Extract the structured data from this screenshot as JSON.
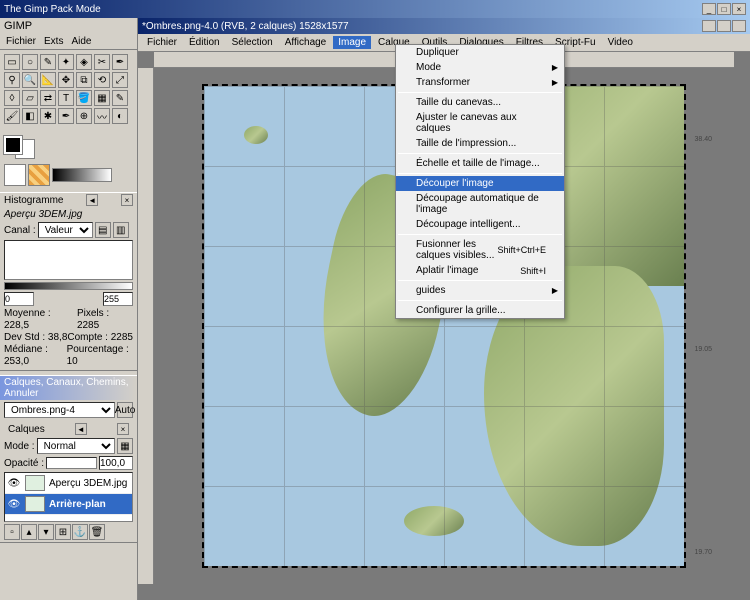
{
  "app": {
    "title": "The Gimp Pack Mode"
  },
  "toolbox": {
    "name": "GIMP",
    "menu": [
      "Fichier",
      "Exts",
      "Aide"
    ]
  },
  "document": {
    "title": "*Ombres.png-4.0 (RVB, 2 calques) 1528x1577",
    "menu": [
      "Fichier",
      "Édition",
      "Sélection",
      "Affichage",
      "Image",
      "Calque",
      "Outils",
      "Dialogues",
      "Filtres",
      "Script-Fu",
      "Video"
    ]
  },
  "image_menu": {
    "items": [
      {
        "label": "Dupliquer"
      },
      {
        "label": "Mode",
        "submenu": true
      },
      {
        "label": "Transformer",
        "submenu": true
      },
      {
        "sep": true
      },
      {
        "label": "Taille du canevas..."
      },
      {
        "label": "Ajuster le canevas aux calques"
      },
      {
        "label": "Taille de l'impression..."
      },
      {
        "sep": true
      },
      {
        "label": "Échelle et taille de l'image..."
      },
      {
        "sep": true
      },
      {
        "label": "Découper l'image",
        "highlighted": true
      },
      {
        "label": "Découpage automatique de l'image"
      },
      {
        "label": "Découpage intelligent..."
      },
      {
        "sep": true
      },
      {
        "label": "Fusionner les calques visibles...",
        "shortcut": "Shift+Ctrl+E"
      },
      {
        "label": "Aplatir l'image",
        "shortcut": "Shift+I"
      },
      {
        "sep": true
      },
      {
        "label": "guides",
        "submenu": true
      },
      {
        "sep": true
      },
      {
        "label": "Configurer la grille..."
      }
    ]
  },
  "histogram": {
    "title": "Histogramme",
    "preview_label": "Aperçu 3DEM.jpg",
    "channel_label": "Canal :",
    "channel_value": "Valeur",
    "range_min": "0",
    "range_max": "255",
    "stats": {
      "moyenne_label": "Moyenne :",
      "moyenne_val": "228,5",
      "pixels_label": "Pixels :",
      "pixels_val": "2285",
      "devstd_label": "Dev Std :",
      "devstd_val": "38,8",
      "compte_label": "Compte :",
      "compte_val": "2285",
      "mediane_label": "Médiane :",
      "mediane_val": "253,0",
      "pourcentage_label": "Pourcentage :",
      "pourcentage_val": "10"
    }
  },
  "layers": {
    "title": "Calques, Canaux, Chemins, Annuler",
    "image_selector": "Ombres.png-4",
    "auto_label": "Auto",
    "tab_label": "Calques",
    "mode_label": "Mode :",
    "mode_value": "Normal",
    "opacity_label": "Opacité :",
    "opacity_value": "100,0",
    "layer1": "Aperçu 3DEM.jpg",
    "layer2": "Arrière-plan"
  },
  "canvas": {
    "coords": [
      "38.40",
      "19.05",
      "19.70"
    ]
  }
}
